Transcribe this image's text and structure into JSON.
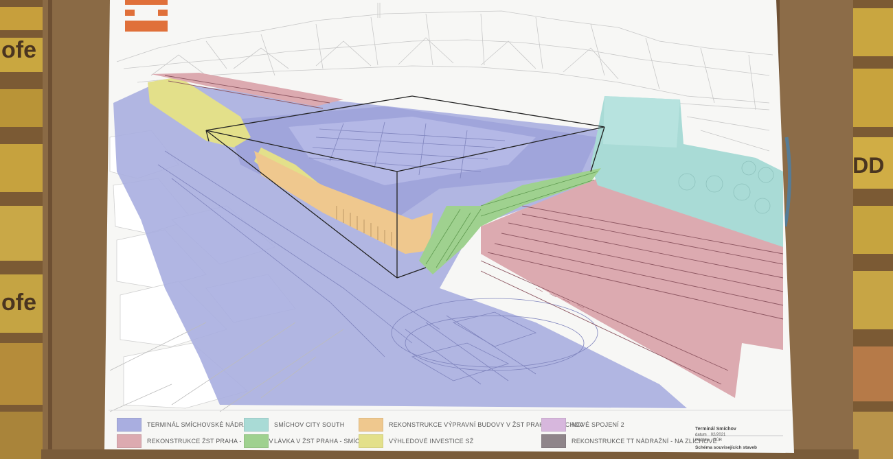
{
  "legend": {
    "items": [
      {
        "label": "TERMINÁL SMÍCHOVSKÉ NÁDRAŽÍ",
        "color": "#a9aee0"
      },
      {
        "label": "REKONSTRUKCE ŽST PRAHA - SMÍCHOV",
        "color": "#dcaab0"
      },
      {
        "label": "SMÍCHOV CITY SOUTH",
        "color": "#a9dbd6"
      },
      {
        "label": "LÁVKA V ŽST PRAHA - SMÍCHOV",
        "color": "#9fd18f"
      },
      {
        "label": "REKONSTRUKCE VÝPRAVNÍ BUDOVY V ŽST PRAHA - SMÍCHOV",
        "color": "#efc88e"
      },
      {
        "label": "VÝHLEDOVÉ INVESTICE SŽ",
        "color": "#e3e08a"
      },
      {
        "label": "NOVÉ SPOJENÍ 2",
        "color": "#d7b7dd"
      },
      {
        "label": "REKONSTRUKCE TT NÁDRAŽNÍ - NA ZLÍCHOVĚ",
        "color": "#8f858a"
      }
    ]
  },
  "infobox": {
    "title": "Terminál Smíchov",
    "date_label": "datum",
    "date_value": "02/2021",
    "scale_label": "Měřítko",
    "scale_value": "DÚR",
    "subtitle": "Schéma souvisejících staveb"
  },
  "fence_text": {
    "left_top": "ofe",
    "left_mid": "ofe",
    "right_mid": "DDD"
  },
  "colors": {
    "wood_post": "#8a6a45",
    "pallet_slat": "#c9a43f",
    "poster_bg": "#f7f7f5"
  }
}
